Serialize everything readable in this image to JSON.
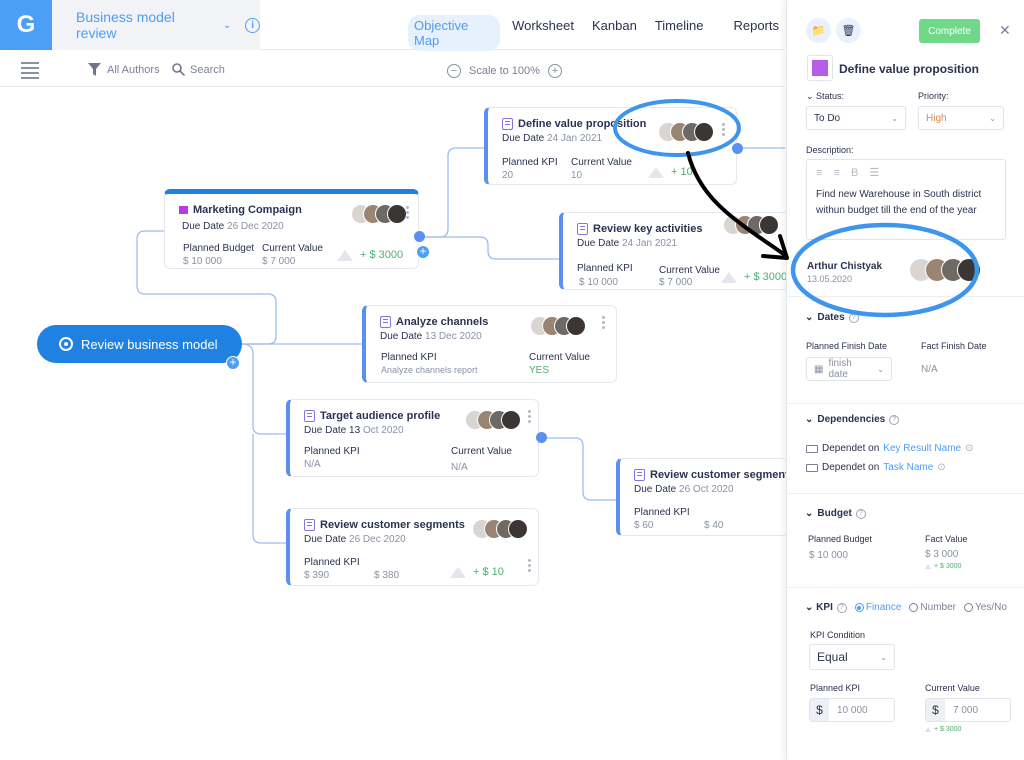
{
  "header": {
    "logo": "G",
    "project_title": "Business model review",
    "tabs": [
      {
        "label": "Objective Map",
        "active": true
      },
      {
        "label": "Worksheet",
        "active": false
      },
      {
        "label": "Kanban",
        "active": false
      },
      {
        "label": "Timeline",
        "active": false
      },
      {
        "label": "Reports",
        "active": false
      }
    ]
  },
  "toolbar": {
    "filter_label": "All Authors",
    "search_label": "Search",
    "scale_label": "Scale to 100%"
  },
  "map": {
    "root": {
      "label": "Review business model"
    },
    "cards": {
      "marketing": {
        "title": "Marketing Compaign",
        "due_label": "Due Date",
        "due_date": "26 Dec 2020",
        "planned_label": "Planned Budget",
        "planned_value": "$ 10 000",
        "current_label": "Current Value",
        "current_value": "$ 7 000",
        "delta": "+ $ 3000"
      },
      "define": {
        "title": "Define value proposition",
        "due_label": "Due Date",
        "due_date": "24 Jan 2021",
        "planned_label": "Planned KPI",
        "planned_value": "20",
        "current_label": "Current Value",
        "current_value": "10",
        "delta": "+ 10"
      },
      "keyact": {
        "title": "Review key activities",
        "due_label": "Due Date",
        "due_date": "24 Jan 2021",
        "planned_label": "Planned KPI",
        "planned_value": "$ 10 000",
        "current_label": "Current Value",
        "current_value": "$ 7 000",
        "delta": "+ $ 3000"
      },
      "channels": {
        "title": "Analyze channels",
        "due_label": "Due Date",
        "due_date": "13 Dec 2020",
        "planned_label": "Planned KPI",
        "planned_value": "Analyze channels report",
        "current_label": "Current Value",
        "current_value": "YES"
      },
      "audience": {
        "title": "Target audience profile",
        "due_label": "Due Date 13",
        "due_date": "Oct 2020",
        "planned_label": "Planned KPI",
        "planned_value": "N/A",
        "current_label": "Current Value",
        "current_value": "N/A"
      },
      "segments1": {
        "title": "Review customer segments",
        "due_label": "Due Date",
        "due_date": "26 Dec 2020",
        "planned_label": "Planned KPI",
        "planned_value": "$ 390",
        "current_value": "$ 380",
        "delta": "+ $ 10"
      },
      "segments2": {
        "title": "Review customer segments",
        "due_label": "Due Date",
        "due_date": "26 Oct 2020",
        "planned_label": "Planned KPI",
        "planned_value": "$ 60",
        "current_value": "$ 40"
      }
    }
  },
  "panel": {
    "complete_label": "Complete",
    "title": "Define value proposition",
    "color": "#b55ee6",
    "status_label": "Status:",
    "status_value": "To Do",
    "priority_label": "Priority:",
    "priority_value": "High",
    "description_label": "Description:",
    "description_format": "≡ ≡ B ☰",
    "description_text": "Find new Warehouse in South district withun budget till the end of the year",
    "author_name": "Arthur Chistyak",
    "author_date": "13.05.2020",
    "dates": {
      "heading": "Dates",
      "planned_label": "Planned Finish Date",
      "planned_placeholder": "finish date",
      "fact_label": "Fact Finish Date",
      "fact_value": "N/A"
    },
    "dependencies": {
      "heading": "Dependencies",
      "items": [
        {
          "prefix": "Dependet on",
          "link": "Key Result Name"
        },
        {
          "prefix": "Dependet on",
          "link": "Task Name"
        }
      ]
    },
    "budget": {
      "heading": "Budget",
      "planned_label": "Planned Budget",
      "planned_value": "$ 10 000",
      "fact_label": "Fact Value",
      "fact_value": "$ 3 000",
      "delta": "+ $ 3000"
    },
    "kpi": {
      "heading": "KPI",
      "options": [
        {
          "label": "Finance",
          "selected": true
        },
        {
          "label": "Number",
          "selected": false
        },
        {
          "label": "Yes/No",
          "selected": false
        }
      ],
      "condition_label": "KPI Condition",
      "condition_value": "Equal",
      "planned_label": "Planned KPI",
      "planned_currency": "$",
      "planned_value": "10 000",
      "current_label": "Current Value",
      "current_currency": "$",
      "current_value": "7 000",
      "delta": "+ $ 3000"
    }
  }
}
